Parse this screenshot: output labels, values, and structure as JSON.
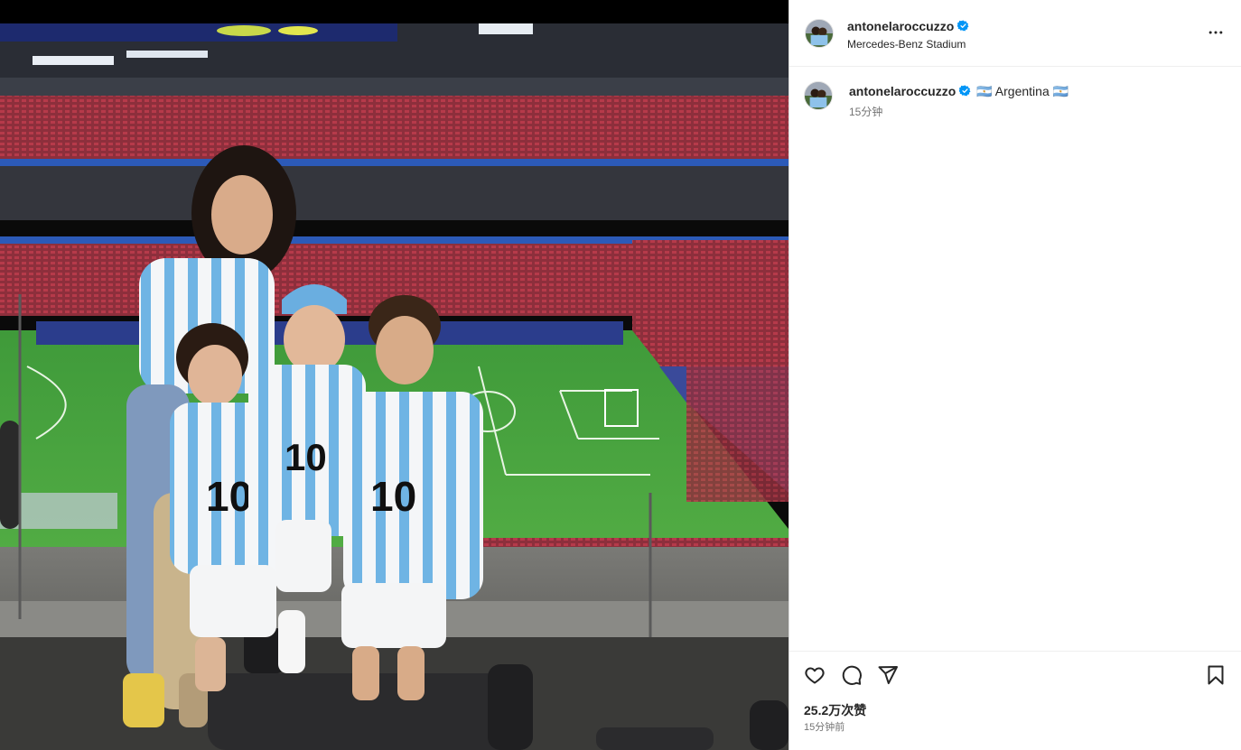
{
  "post": {
    "username": "antonelaroccuzzo",
    "location": "Mercedes-Benz Stadium",
    "verified": true,
    "caption": "🇦🇷 Argentina 🇦🇷",
    "caption_time": "15分钟",
    "likes": "25.2万次赞",
    "posted": "15分钟前"
  },
  "icons": {
    "more": "more-options-icon",
    "like": "heart-icon",
    "comment": "comment-icon",
    "share": "share-icon",
    "save": "bookmark-icon",
    "verified": "verified-badge-icon"
  },
  "colors": {
    "verified": "#0095f6",
    "text": "#262626",
    "muted": "#737373",
    "divider": "#efefef"
  }
}
